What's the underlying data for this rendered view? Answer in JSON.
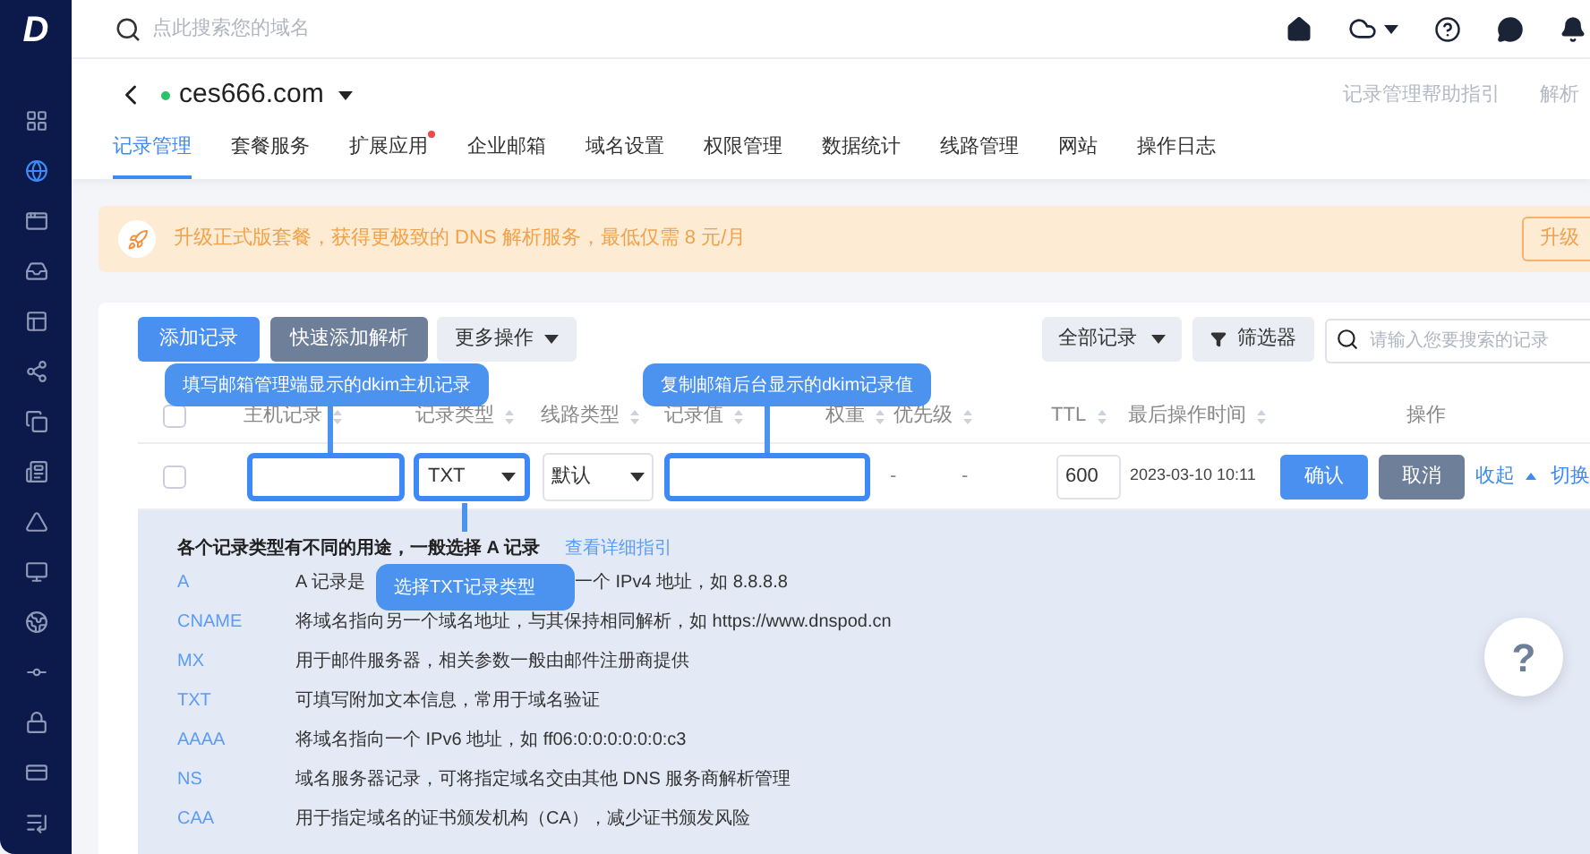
{
  "logo": "D",
  "sidebar": {
    "items": [
      {
        "selected": false
      },
      {
        "selected": true
      },
      {
        "selected": false
      },
      {
        "selected": false
      },
      {
        "selected": false
      },
      {
        "selected": false
      },
      {
        "selected": false
      },
      {
        "selected": false
      },
      {
        "selected": false
      },
      {
        "selected": false
      },
      {
        "selected": false
      },
      {
        "selected": false
      },
      {
        "selected": false
      },
      {
        "selected": false
      },
      {
        "selected": false
      }
    ]
  },
  "topbar": {
    "search_placeholder": "点此搜索您的域名"
  },
  "domain": {
    "name": "ces666.com",
    "online": true,
    "links": [
      "记录管理帮助指引",
      "解析"
    ]
  },
  "tabs": [
    {
      "label": "记录管理",
      "selected": true,
      "dot": false
    },
    {
      "label": "套餐服务",
      "selected": false,
      "dot": false
    },
    {
      "label": "扩展应用",
      "selected": false,
      "dot": true
    },
    {
      "label": "企业邮箱",
      "selected": false,
      "dot": false
    },
    {
      "label": "域名设置",
      "selected": false,
      "dot": false
    },
    {
      "label": "权限管理",
      "selected": false,
      "dot": false
    },
    {
      "label": "数据统计",
      "selected": false,
      "dot": false
    },
    {
      "label": "线路管理",
      "selected": false,
      "dot": false
    },
    {
      "label": "网站",
      "selected": false,
      "dot": false
    },
    {
      "label": "操作日志",
      "selected": false,
      "dot": false
    }
  ],
  "banner": {
    "text": "升级正式版套餐，获得更极致的 DNS 解析服务，最低仅需 8 元/月",
    "button": "升级"
  },
  "toolbar": {
    "add": "添加记录",
    "quick_add": "快速添加解析",
    "more": "更多操作",
    "filter_all": "全部记录",
    "filter": "筛选器",
    "search_placeholder": "请输入您要搜索的记录"
  },
  "table": {
    "columns": [
      "主机记录",
      "记录类型",
      "线路类型",
      "记录值",
      "权重",
      "优先级",
      "TTL",
      "最后操作时间",
      "操作"
    ],
    "select_all_checked": false,
    "edit_row": {
      "checked": false,
      "type": "TXT",
      "line": "默认",
      "weight": "-",
      "priority": "-",
      "ttl": "600",
      "time": "2023-03-10 10:11",
      "confirm": "确认",
      "cancel": "取消",
      "collapse": "收起",
      "switch": "切换"
    }
  },
  "help": {
    "title": "各个记录类型有不同的用途，一般选择 A 记录",
    "link": "查看详细指引",
    "rows": [
      {
        "type": "A",
        "parts": [
          "A 记录是",
          "一个 IPv4 地址，如 8.8.8.8"
        ]
      },
      {
        "type": "CNAME",
        "parts": [
          "将域名指向另一个域名地址，与其保持相同解析，如 https://www.dnspod.cn"
        ]
      },
      {
        "type": "MX",
        "parts": [
          "用于邮件服务器，相关参数一般由邮件注册商提供"
        ]
      },
      {
        "type": "TXT",
        "parts": [
          "可填写附加文本信息，常用于域名验证"
        ]
      },
      {
        "type": "AAAA",
        "parts": [
          "将域名指向一个 IPv6 地址，如 ff06:0:0:0:0:0:0:c3"
        ]
      },
      {
        "type": "NS",
        "parts": [
          "域名服务器记录，可将指定域名交由其他 DNS 服务商解析管理"
        ]
      },
      {
        "type": "CAA",
        "parts": [
          "用于指定域名的证书颁发机构（CA），减少证书颁发风险"
        ]
      }
    ]
  },
  "callouts": [
    "填写邮箱管理端显示的dkim主机记录",
    "复制邮箱后台显示的dkim记录值",
    "选择TXT记录类型"
  ],
  "help_button": "?"
}
